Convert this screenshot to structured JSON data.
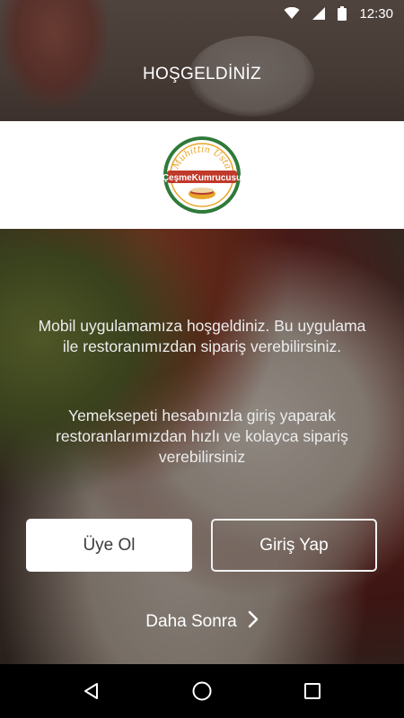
{
  "status_bar": {
    "time": "12:30",
    "icons": [
      "wifi-icon",
      "signal-icon",
      "battery-icon"
    ]
  },
  "header": {
    "title": "HOŞGELDİNİZ"
  },
  "logo": {
    "top_text": "Muhittin Usta",
    "brand_text": "ÇeşmeKumrucusu",
    "colors": {
      "ring": "#2f7a3a",
      "accent": "#e7a52a",
      "brand_red": "#c0392b"
    }
  },
  "content": {
    "welcome_text": "Mobil uygulamamıza hoşgeldiniz. Bu uygulama ile restoranımızdan sipariş verebilirsiniz.",
    "info_text": "Yemeksepeti hesabınızla giriş yaparak restoranlarımızdan hızlı ve kolayca sipariş verebilirsiniz"
  },
  "buttons": {
    "register_label": "Üye Ol",
    "login_label": "Giriş Yap",
    "later_label": "Daha Sonra"
  },
  "nav_bar": {
    "icons": [
      "back-icon",
      "home-icon",
      "recents-icon"
    ]
  }
}
